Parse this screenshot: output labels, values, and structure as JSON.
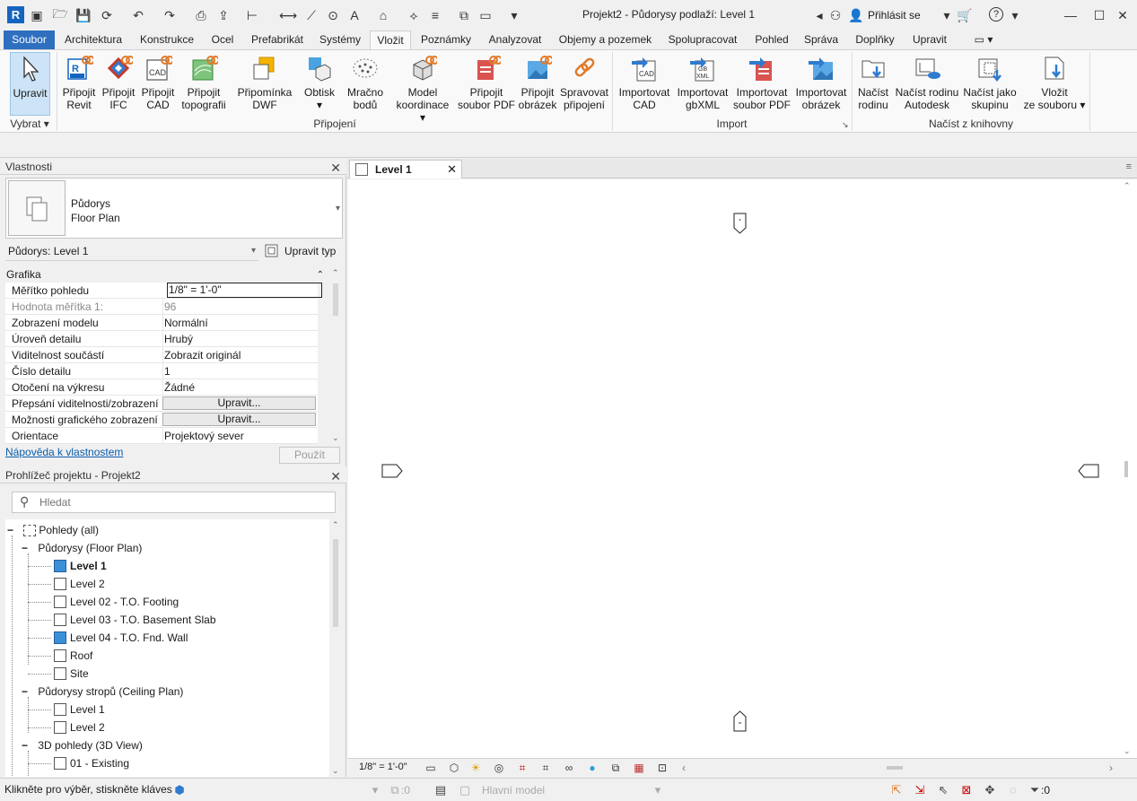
{
  "window": {
    "title": "Projekt2 - Půdorysy podlaží: Level 1",
    "signin": "Přihlásit se",
    "help": "?"
  },
  "tabs": [
    "Soubor",
    "Architektura",
    "Konstrukce",
    "Ocel",
    "Prefabrikát",
    "Systémy",
    "Vložit",
    "Poznámky",
    "Analyzovat",
    "Objemy a pozemek",
    "Spolupracovat",
    "Pohled",
    "Správa",
    "Doplňky",
    "Upravit"
  ],
  "ribbon": {
    "select_panel": "Vybrat",
    "buttons": [
      {
        "label1": "Upravit",
        "label2": ""
      },
      {
        "label1": "Připojit",
        "label2": "Revit"
      },
      {
        "label1": "Připojit",
        "label2": "IFC"
      },
      {
        "label1": "Připojit",
        "label2": "CAD"
      },
      {
        "label1": "Připojit",
        "label2": "topografii"
      },
      {
        "label1": "Připomínka",
        "label2": "DWF"
      },
      {
        "label1": "Obtisk",
        "label2": ""
      },
      {
        "label1": "Mračno",
        "label2": "bodů"
      },
      {
        "label1": "Model",
        "label2": "koordinace"
      },
      {
        "label1": "Připojit",
        "label2": "soubor PDF"
      },
      {
        "label1": "Připojit",
        "label2": "obrázek"
      },
      {
        "label1": "Spravovat",
        "label2": "připojení"
      },
      {
        "label1": "Importovat",
        "label2": "CAD"
      },
      {
        "label1": "Importovat",
        "label2": "gbXML"
      },
      {
        "label1": "Importovat",
        "label2": "soubor PDF"
      },
      {
        "label1": "Importovat",
        "label2": "obrázek"
      },
      {
        "label1": "Načíst",
        "label2": "rodinu"
      },
      {
        "label1": "Načíst rodinu",
        "label2": "Autodesk"
      },
      {
        "label1": "Načíst jako",
        "label2": "skupinu"
      },
      {
        "label1": "Vložit",
        "label2": "ze souboru"
      }
    ],
    "panels": [
      "Připojení",
      "Import",
      "Načíst z knihovny"
    ]
  },
  "properties": {
    "title": "Vlastnosti",
    "type_line1": "Půdorys",
    "type_line2": "Floor Plan",
    "selector": "Půdorys: Level 1",
    "edit_type": "Upravit typ",
    "group": "Grafika",
    "rows": [
      {
        "k": "Měřítko pohledu",
        "v": "1/8\" = 1'-0\""
      },
      {
        "k": "Hodnota měřítka    1:",
        "v": "96"
      },
      {
        "k": "Zobrazení modelu",
        "v": "Normální"
      },
      {
        "k": "Úroveň detailu",
        "v": "Hrubý"
      },
      {
        "k": "Viditelnost součástí",
        "v": "Zobrazit originál"
      },
      {
        "k": "Číslo detailu",
        "v": "1"
      },
      {
        "k": "Otočení na výkresu",
        "v": "Žádné"
      },
      {
        "k": "Přepsání viditelnosti/zobrazení",
        "v": "Upravit..."
      },
      {
        "k": "Možnosti grafického zobrazení",
        "v": "Upravit..."
      },
      {
        "k": "Orientace",
        "v": "Projektový sever"
      }
    ],
    "help_link": "Nápověda k vlastnostem",
    "apply": "Použít"
  },
  "browser": {
    "title": "Prohlížeč projektu - Projekt2",
    "search_placeholder": "Hledat",
    "root": "Pohledy (all)",
    "floor_plans": "Půdorysy (Floor Plan)",
    "floor_items": [
      "Level 1",
      "Level 2",
      "Level 02 - T.O. Footing",
      "Level 03 - T.O. Basement Slab",
      "Level 04 - T.O. Fnd. Wall",
      "Roof",
      "Site"
    ],
    "ceiling_plans": "Půdorysy stropů (Ceiling Plan)",
    "ceiling_items": [
      "Level 1",
      "Level 2"
    ],
    "views3d": "3D pohledy (3D View)",
    "views3d_items": [
      "01 - Existing"
    ]
  },
  "view": {
    "tab": "Level 1",
    "scale": "1/8\" = 1'-0\""
  },
  "status": {
    "hint": "Klikněte pro výběr, stiskněte kláves",
    "count1": ":0",
    "model": "Hlavní model",
    "filter": ":0"
  }
}
